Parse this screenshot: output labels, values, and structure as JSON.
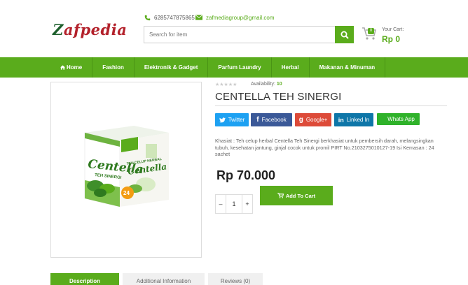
{
  "brand": {
    "logo_first": "Z",
    "logo_rest": "afpedia"
  },
  "contact": {
    "phone": "6285747875865",
    "email": "zafmediagroup@gmail.com"
  },
  "search": {
    "placeholder": "Search for item"
  },
  "cart": {
    "count": "0",
    "label": "Your Cart:",
    "amount": "Rp 0"
  },
  "nav": {
    "items": [
      {
        "label": "Home"
      },
      {
        "label": "Fashion"
      },
      {
        "label": "Elektronik & Gadget"
      },
      {
        "label": "Parfum Laundry"
      },
      {
        "label": "Herbal"
      },
      {
        "label": "Makanan & Minuman"
      }
    ]
  },
  "product": {
    "rating_stars": "★★★★★",
    "availability_label": "Availability:",
    "availability_value": "10",
    "title": "CENTELLA TEH SINERGI",
    "description": "Khasiat : Teh celup herbal Centella Teh Sinergi berkhasiat untuk pembersih darah, melangsingkan tubuh, kesehatan jantung, ginjal cocok untuk promil PIRT No.2103275010127-19 Isi Kemasan : 24 sachet",
    "price": "Rp 70.000",
    "quantity": "1",
    "add_to_cart": "Add To Cart",
    "package": {
      "brand": "Centella",
      "subtitle": "TEH SINERGI",
      "side_text": "TEH CELUP HERBAL",
      "side_brand": "Centella",
      "count": "24"
    }
  },
  "share": {
    "twitter": "Twitter",
    "facebook": "Facebook",
    "google": "Google+",
    "linkedin": "Linked In",
    "whatsapp": "Whats App"
  },
  "tabs": {
    "description": "Description",
    "additional": "Additional Information",
    "reviews": "Reviews (0)"
  },
  "colors": {
    "accent": "#5aac1c",
    "twitter": "#1da1f2",
    "facebook": "#3b5998",
    "google": "#dd4b39",
    "linkedin": "#0e76a8",
    "whatsapp": "#2fb22a"
  }
}
